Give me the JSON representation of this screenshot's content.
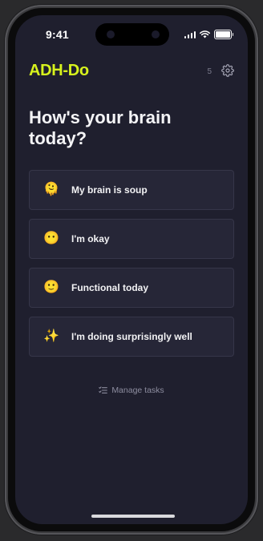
{
  "status_bar": {
    "time": "9:41"
  },
  "app": {
    "logo": "ADH-Do",
    "count": "5",
    "accent_color": "#d7f21d"
  },
  "prompt": {
    "heading": "How's your brain today?"
  },
  "moods": [
    {
      "icon": "🫠",
      "icon_name": "melting-face-icon",
      "label": "My brain is soup"
    },
    {
      "icon": "😶",
      "icon_name": "neutral-face-icon",
      "label": "I'm okay"
    },
    {
      "icon": "🙂",
      "icon_name": "smiling-face-icon",
      "label": "Functional today"
    },
    {
      "icon": "✨",
      "icon_name": "sparkles-icon",
      "label": "I'm doing surprisingly well"
    }
  ],
  "footer": {
    "manage_label": "Manage tasks",
    "manage_icon": "task-list-icon"
  }
}
